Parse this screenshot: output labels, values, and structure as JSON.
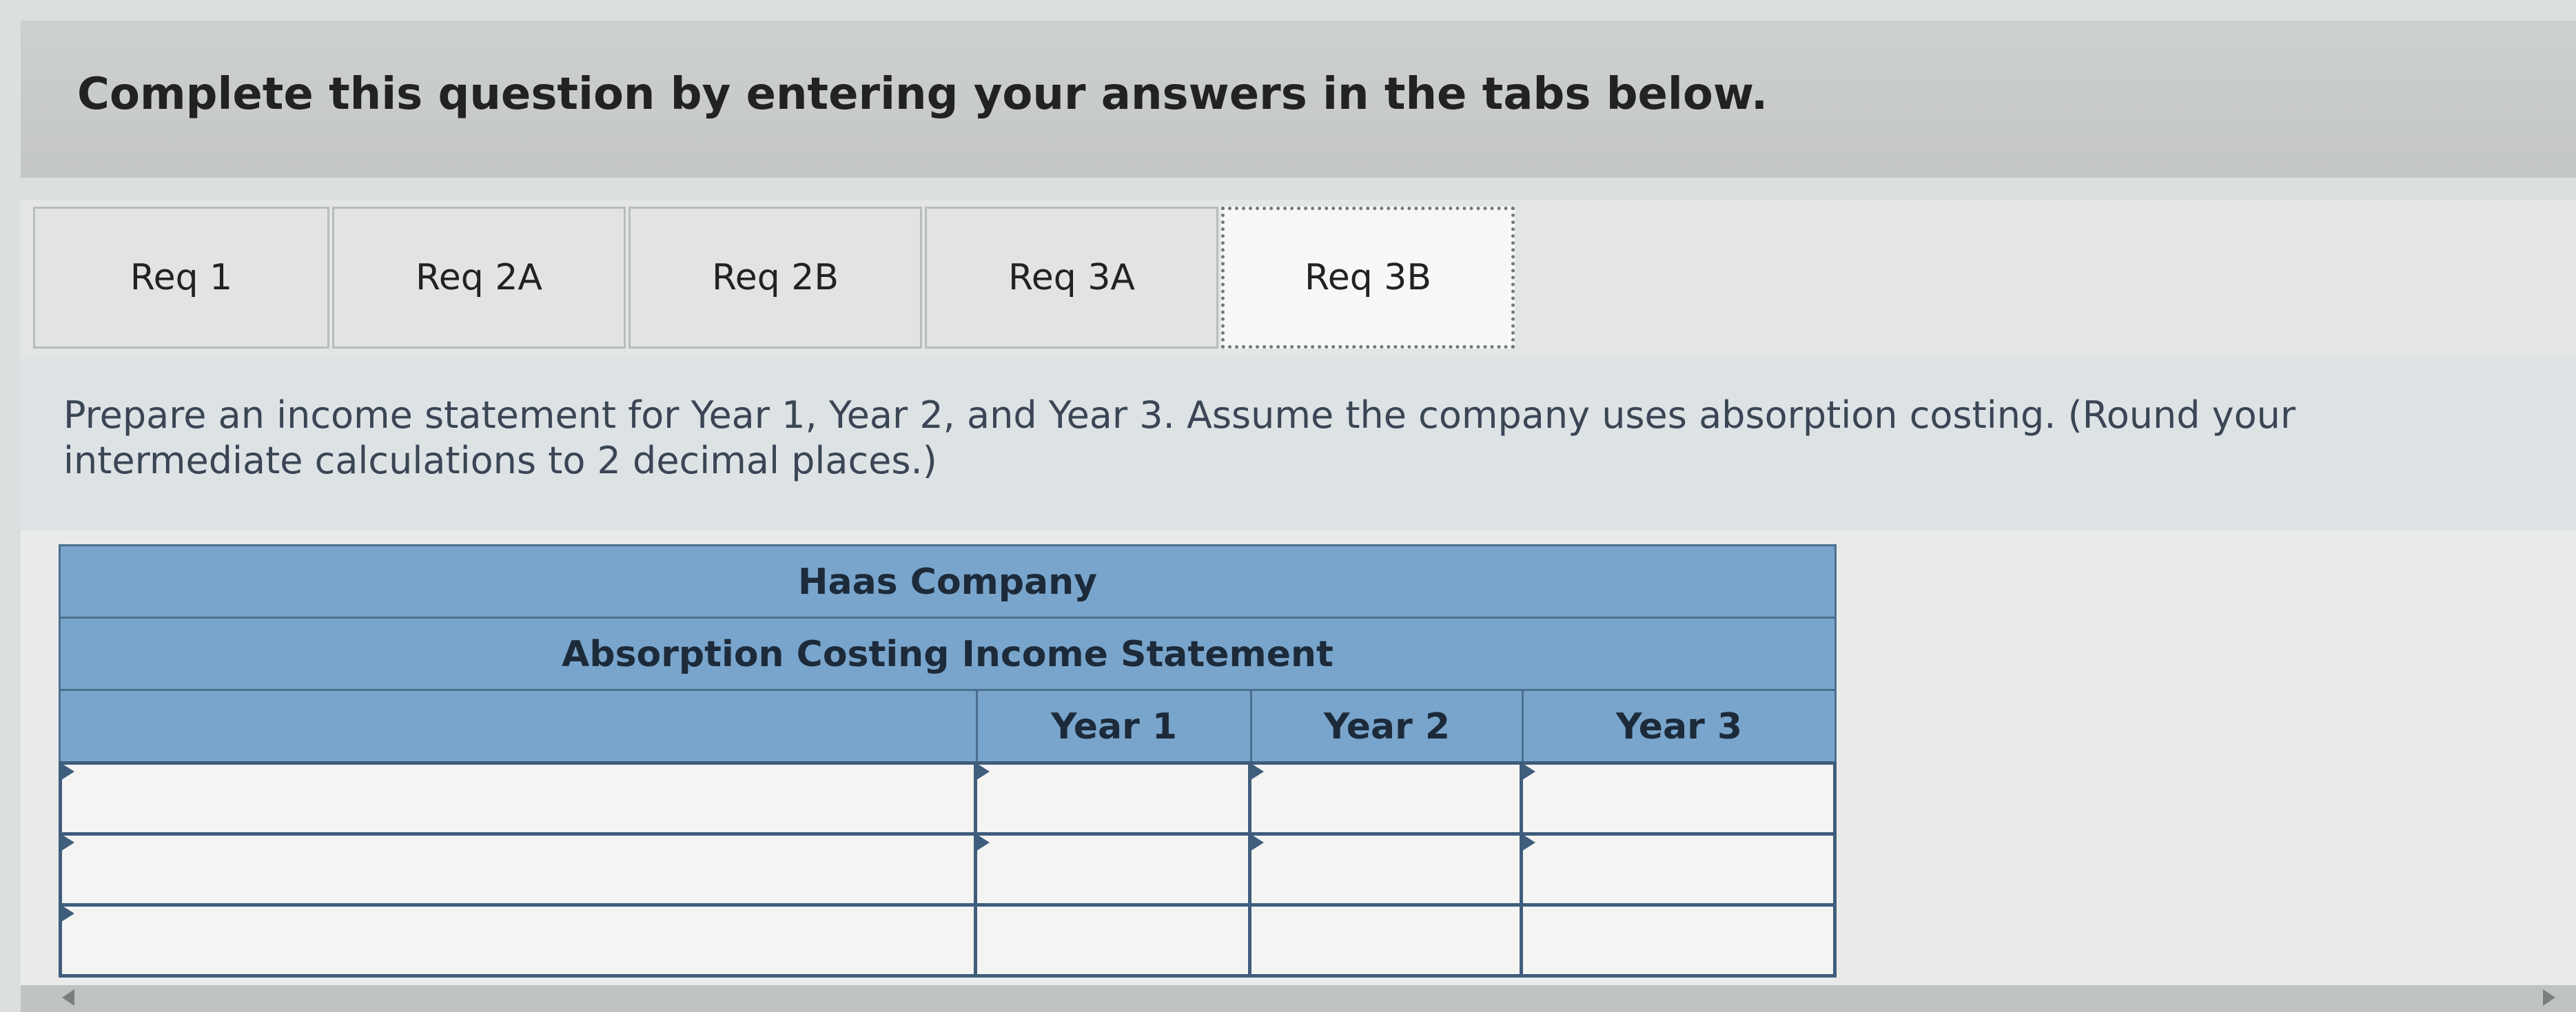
{
  "banner": {
    "title": "Complete this question by entering your answers in the tabs below."
  },
  "tabs": [
    {
      "label": "Req 1",
      "active": false
    },
    {
      "label": "Req 2A",
      "active": false
    },
    {
      "label": "Req 2B",
      "active": false
    },
    {
      "label": "Req 3A",
      "active": false
    },
    {
      "label": "Req 3B",
      "active": true
    }
  ],
  "instructions": "Prepare an income statement for Year 1, Year 2, and Year 3. Assume the company uses absorption costing. (Round your intermediate calculations to 2 decimal places.)",
  "statement": {
    "company": "Haas Company",
    "title": "Absorption Costing Income Statement",
    "columns": [
      "Year 1",
      "Year 2",
      "Year 3"
    ],
    "rows": [
      {
        "label": "",
        "values": [
          "",
          "",
          ""
        ]
      },
      {
        "label": "",
        "values": [
          "",
          "",
          ""
        ]
      },
      {
        "label": "",
        "values": [
          "",
          "",
          ""
        ]
      }
    ]
  },
  "colors": {
    "header_blue": "#79a5cc",
    "border_blue": "#3f5d7c"
  }
}
